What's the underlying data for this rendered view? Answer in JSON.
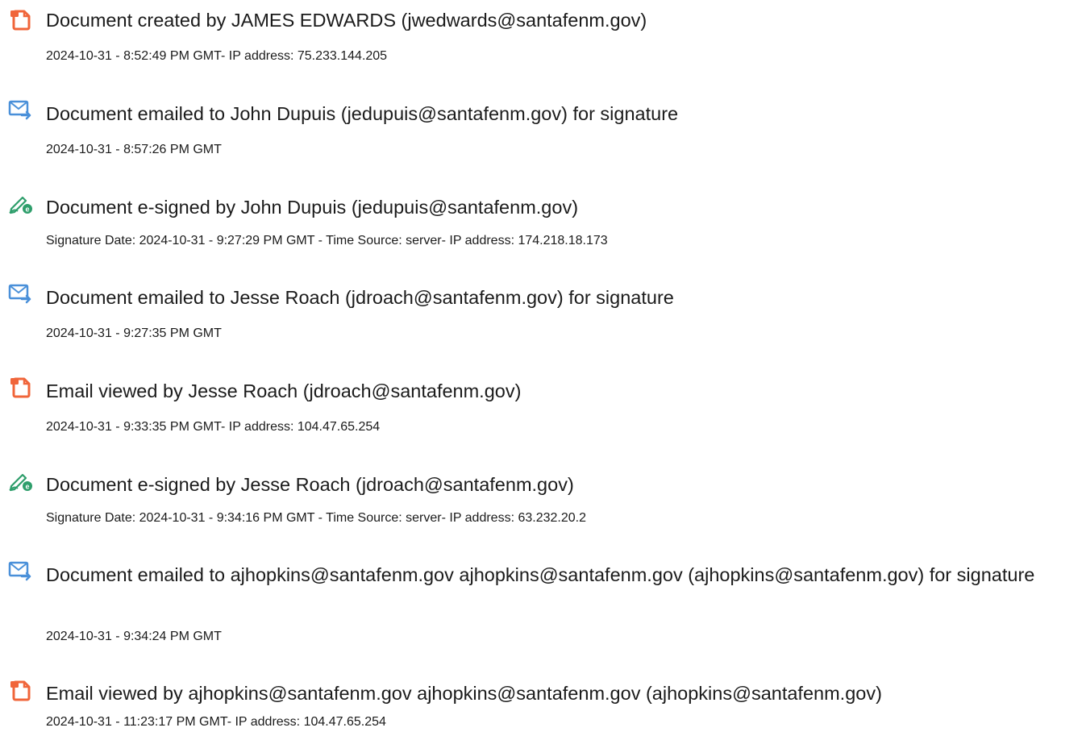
{
  "events": [
    {
      "icon": "document-created-icon",
      "title": "Document created by JAMES EDWARDS (jwedwards@santafenm.gov)",
      "detail": "2024-10-31 - 8:52:49 PM GMT- IP address: 75.233.144.205"
    },
    {
      "icon": "email-sent-icon",
      "title": "Document emailed to John Dupuis (jedupuis@santafenm.gov) for signature",
      "detail": "2024-10-31 - 8:57:26 PM GMT"
    },
    {
      "icon": "esign-pen-icon",
      "title": "Document e-signed by John Dupuis (jedupuis@santafenm.gov)",
      "detail": "Signature Date: 2024-10-31 - 9:27:29 PM GMT - Time Source: server- IP address: 174.218.18.173"
    },
    {
      "icon": "email-sent-icon",
      "title": "Document emailed to Jesse Roach (jdroach@santafenm.gov) for signature",
      "detail": "2024-10-31 - 9:27:35 PM GMT"
    },
    {
      "icon": "document-viewed-icon",
      "title": "Email viewed by Jesse Roach (jdroach@santafenm.gov)",
      "detail": "2024-10-31 - 9:33:35 PM GMT- IP address: 104.47.65.254"
    },
    {
      "icon": "esign-pen-icon",
      "title": "Document e-signed by Jesse Roach (jdroach@santafenm.gov)",
      "detail": "Signature Date: 2024-10-31 - 9:34:16 PM GMT - Time Source: server- IP address: 63.232.20.2"
    },
    {
      "icon": "email-sent-icon",
      "title": "Document emailed to ajhopkins@santafenm.gov ajhopkins@santafenm.gov (ajhopkins@santafenm.gov) for signature",
      "detail": "2024-10-31 - 9:34:24 PM GMT"
    },
    {
      "icon": "document-viewed-icon",
      "title": "Email viewed by ajhopkins@santafenm.gov ajhopkins@santafenm.gov (ajhopkins@santafenm.gov)",
      "detail": "2024-10-31 - 11:23:17 PM GMT- IP address: 104.47.65.254"
    }
  ],
  "colors": {
    "document_icon": "#f0653a",
    "email_icon": "#4a90d9",
    "pen_icon": "#2e9e6b"
  }
}
